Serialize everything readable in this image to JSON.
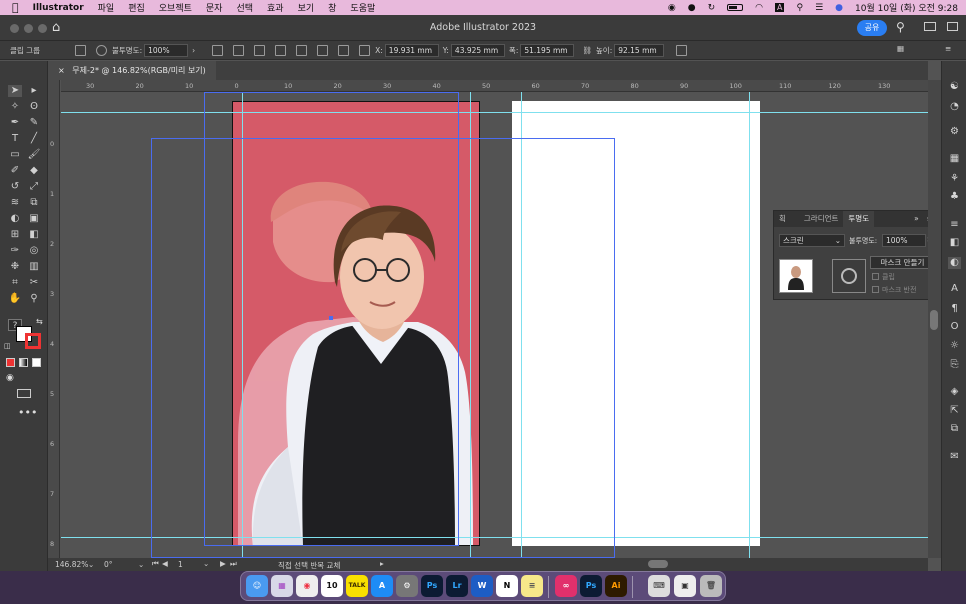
{
  "menubar": {
    "apple": "",
    "app_name": "Illustrator",
    "items": [
      "파일",
      "편집",
      "오브젝트",
      "문자",
      "선택",
      "효과",
      "보기",
      "창",
      "도움말"
    ],
    "datetime": "10월 10일 (화) 오전 9:28"
  },
  "window": {
    "title": "Adobe Illustrator 2023",
    "share_label": "공유"
  },
  "control_bar": {
    "selection_label": "클립 그룹",
    "opacity_label": "불투명도:",
    "opacity_value": "100%",
    "x_label": "X:",
    "x_value": "19.931 mm",
    "y_label": "Y:",
    "y_value": "43.925 mm",
    "w_label": "폭:",
    "w_value": "51.195 mm",
    "h_label": "높이:",
    "h_value": "92.15 mm"
  },
  "document_tab": {
    "title": "무제-2* @ 146.82%(RGB/미리 보기)"
  },
  "ruler": {
    "h_ticks": [
      "30",
      "20",
      "10",
      "0",
      "10",
      "20",
      "30",
      "40",
      "50",
      "60",
      "70",
      "80",
      "90",
      "100",
      "110",
      "120",
      "130"
    ],
    "v_ticks": [
      "0",
      "1",
      "2",
      "3",
      "4",
      "5",
      "6",
      "7",
      "8",
      "9"
    ]
  },
  "status_bar": {
    "zoom": "146.82%",
    "rotation": "0°",
    "artboard": "1",
    "status_text": "직접 선택 반복 교체"
  },
  "transparency_panel": {
    "tabs": [
      "획",
      "그라디언트",
      "투명도"
    ],
    "active_tab": "투명도",
    "blend_mode": "스크린",
    "opacity_label": "불투명도:",
    "opacity_value": "100%",
    "make_mask_label": "마스크 만들기",
    "clip_label": "클립",
    "invert_mask_label": "마스크 반전"
  },
  "dock": {
    "calendar_day": "10",
    "apps": [
      "Finder",
      "Launchpad",
      "Chrome",
      "Calendar",
      "KakaoTalk",
      "App Store",
      "System Settings",
      "Photoshop",
      "Lightroom",
      "Word",
      "Notion",
      "Notes",
      "Creative Cloud",
      "Photoshop",
      "Illustrator",
      "Keyboard",
      "Preview",
      "Trash"
    ],
    "labels": {
      "ps": "Ps",
      "lr": "Lr",
      "ai": "Ai",
      "w": "W",
      "n": "N",
      "talk": "TALK"
    }
  },
  "colors": {
    "artboard_red": "#d55a68",
    "accent_blue": "#2a7ef2",
    "guide_cyan": "#7fe0ee",
    "selection_blue": "#4a6cf0"
  }
}
